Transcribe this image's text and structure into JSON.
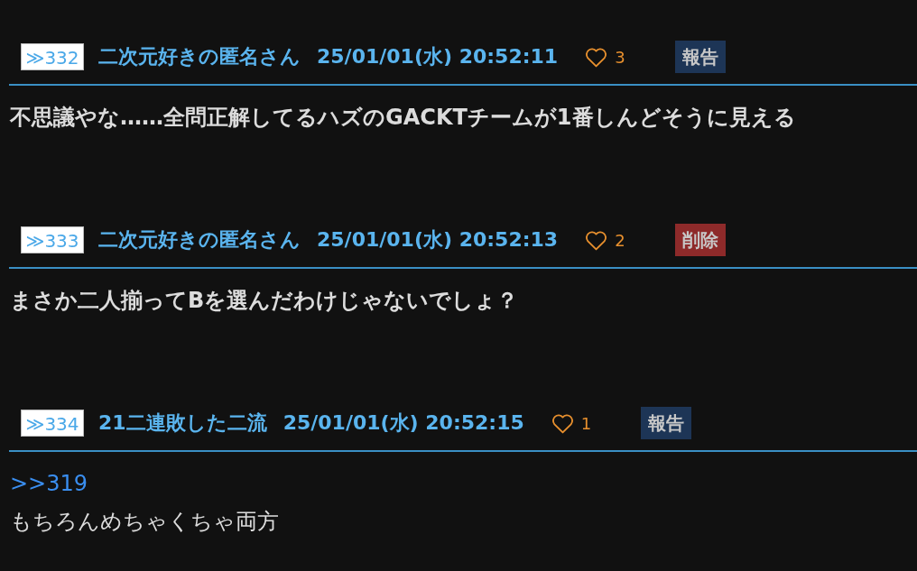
{
  "posts": [
    {
      "number": "≫332",
      "name": "二次元好きの匿名さん",
      "date": "25/01/01(水) 20:52:11",
      "likes": "3",
      "action": {
        "kind": "report",
        "label": "報告"
      },
      "lines": [
        {
          "kind": "bold_text",
          "text": "不思議やな……全問正解してるハズのGACKTチームが1番しんどそうに見える"
        }
      ]
    },
    {
      "number": "≫333",
      "name": "二次元好きの匿名さん",
      "date": "25/01/01(水) 20:52:13",
      "likes": "2",
      "action": {
        "kind": "delete",
        "label": "削除"
      },
      "lines": [
        {
          "kind": "bold_text",
          "text": "まさか二人揃ってBを選んだわけじゃないでしょ？"
        }
      ]
    },
    {
      "number": "≫334",
      "name": "21二連敗した二流",
      "date": "25/01/01(水) 20:52:15",
      "likes": "1",
      "action": {
        "kind": "report",
        "label": "報告"
      },
      "lines": [
        {
          "kind": "anchor",
          "text": ">>319"
        },
        {
          "kind": "text",
          "text": "もちろんめちゃくちゃ両方"
        }
      ]
    }
  ]
}
